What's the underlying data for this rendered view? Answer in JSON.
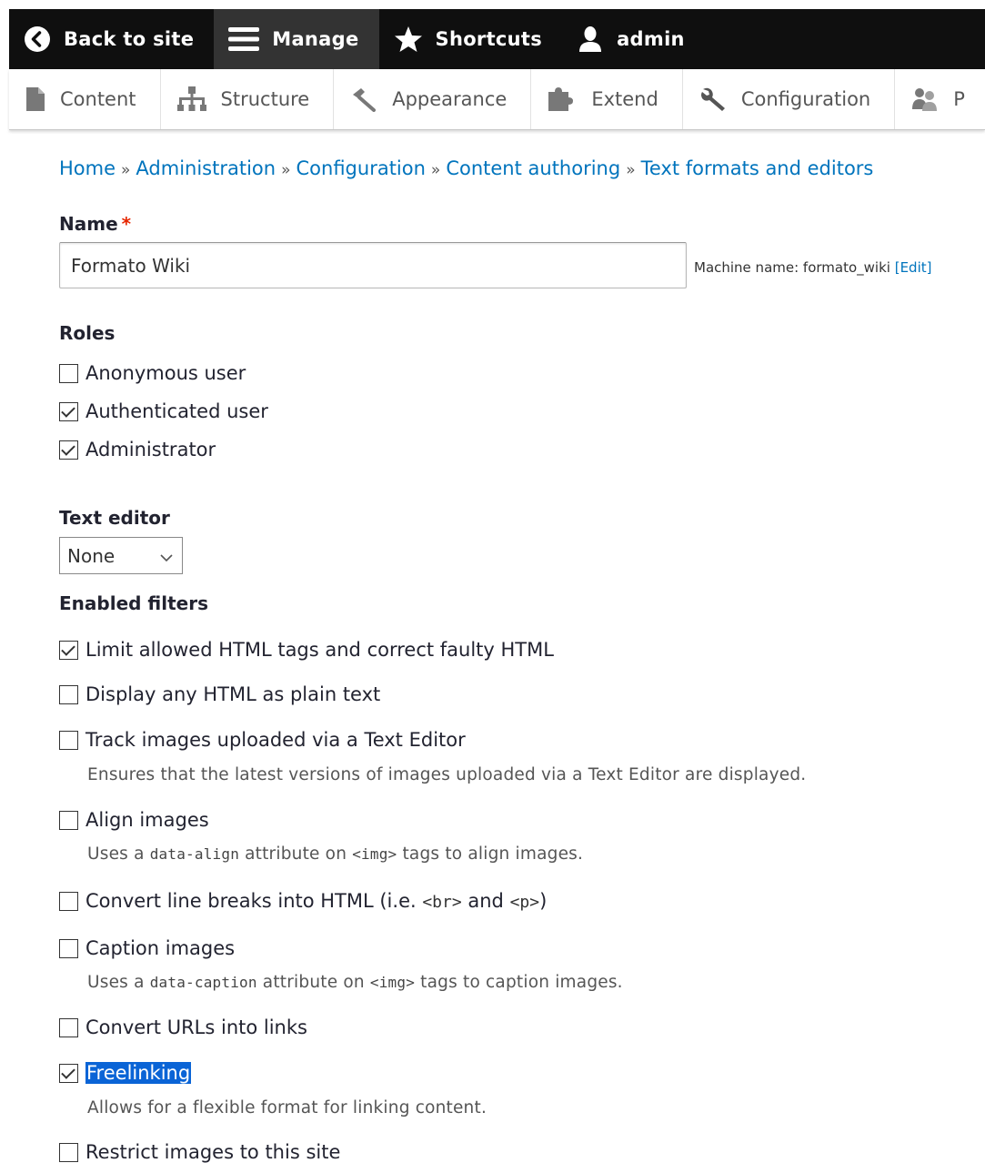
{
  "toolbar": {
    "back_to_site": "Back to site",
    "manage": "Manage",
    "shortcuts": "Shortcuts",
    "user": "admin"
  },
  "tray": {
    "items": [
      {
        "label": "Content",
        "icon": "file-icon"
      },
      {
        "label": "Structure",
        "icon": "sitemap-icon"
      },
      {
        "label": "Appearance",
        "icon": "paint-brush-icon"
      },
      {
        "label": "Extend",
        "icon": "puzzle-icon"
      },
      {
        "label": "Configuration",
        "icon": "wrench-icon"
      },
      {
        "label": "P",
        "icon": "people-icon"
      }
    ]
  },
  "breadcrumb": {
    "items": [
      "Home",
      "Administration",
      "Configuration",
      "Content authoring",
      "Text formats and editors"
    ],
    "separator": "»"
  },
  "form": {
    "name_label": "Name",
    "required_mark": "*",
    "name_value": "Formato Wiki",
    "machine_name_prefix": "Machine name: formato_wiki",
    "machine_name_edit": "[Edit]",
    "roles_label": "Roles",
    "roles": [
      {
        "label": "Anonymous user",
        "checked": false
      },
      {
        "label": "Authenticated user",
        "checked": true
      },
      {
        "label": "Administrator",
        "checked": true
      }
    ],
    "text_editor_label": "Text editor",
    "text_editor_value": "None",
    "filters_label": "Enabled filters",
    "filters": [
      {
        "label": "Limit allowed HTML tags and correct faulty HTML",
        "checked": true
      },
      {
        "label": "Display any HTML as plain text",
        "checked": false
      },
      {
        "label": "Track images uploaded via a Text Editor",
        "checked": false,
        "description": "Ensures that the latest versions of images uploaded via a Text Editor are displayed."
      },
      {
        "label": "Align images",
        "checked": false,
        "desc_pre": "Uses a ",
        "desc_code": "data-align",
        "desc_mid": " attribute on ",
        "desc_code2": "<img>",
        "desc_post": " tags to align images."
      },
      {
        "label_pre": "Convert line breaks into HTML (i.e. ",
        "label_code1": "<br>",
        "label_mid": " and ",
        "label_code2": "<p>",
        "label_post": ")",
        "checked": false
      },
      {
        "label": "Caption images",
        "checked": false,
        "desc_pre": "Uses a ",
        "desc_code": "data-caption",
        "desc_mid": " attribute on ",
        "desc_code2": "<img>",
        "desc_post": " tags to caption images."
      },
      {
        "label": "Convert URLs into links",
        "checked": false
      },
      {
        "label": "Freelinking",
        "checked": true,
        "description": "Allows for a flexible format for linking content."
      },
      {
        "label": "Restrict images to this site",
        "checked": false
      }
    ]
  },
  "colors": {
    "toolbar_bg": "#0f0f0f",
    "link": "#0074bd",
    "required": "#e62600",
    "selection": "#0a64d6"
  }
}
